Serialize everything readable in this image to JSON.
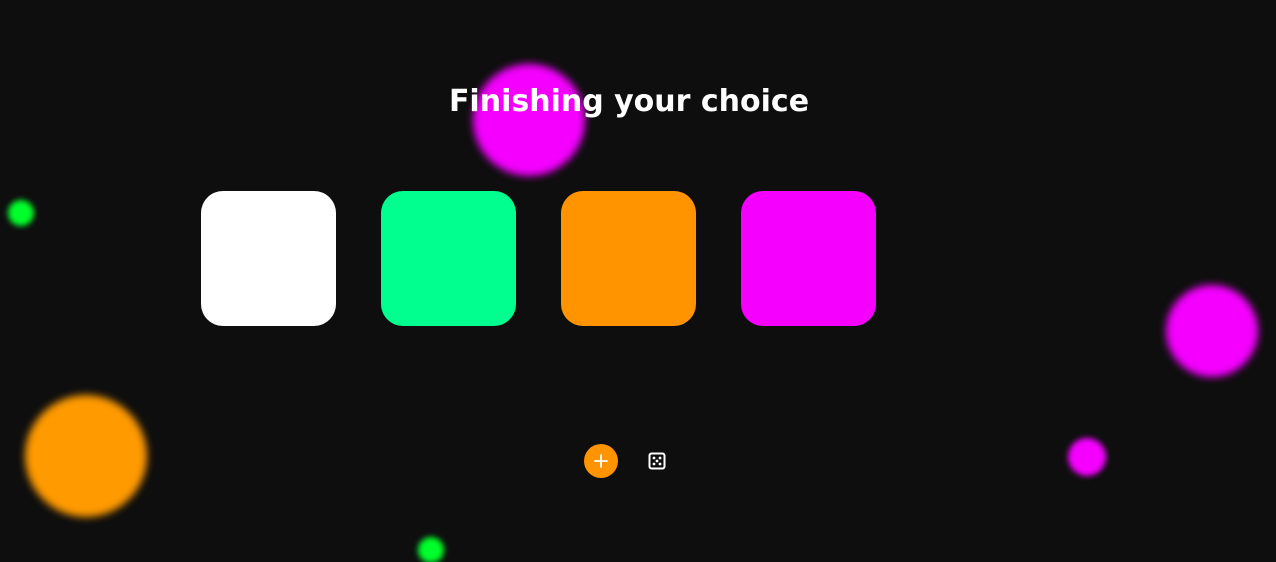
{
  "title": "Finishing your choice",
  "colors": {
    "background": "#0e0e0e",
    "title_text": "#ffffff",
    "accent": "#ff9400"
  },
  "swatches": [
    {
      "name": "white",
      "color": "#ffffff"
    },
    {
      "name": "green",
      "color": "#00ff8f"
    },
    {
      "name": "orange",
      "color": "#ff9400"
    },
    {
      "name": "magenta",
      "color": "#f500ff"
    }
  ],
  "blobs": [
    {
      "color": "#f500ff"
    },
    {
      "color": "#00ff2a"
    },
    {
      "color": "#f500ff"
    },
    {
      "color": "#ff9a00"
    },
    {
      "color": "#f500ff"
    },
    {
      "color": "#00ff2a"
    }
  ],
  "controls": {
    "add_icon": "plus-icon",
    "random_icon": "dice-icon"
  }
}
